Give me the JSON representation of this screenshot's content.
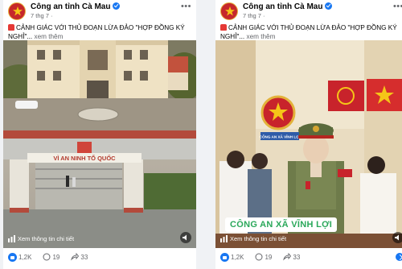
{
  "posts": [
    {
      "page_name": "Công an tỉnh Cà Mau",
      "time": "7 thg 7 ·",
      "caption": "CẢNH GIÁC VỚI THỦ ĐOẠN LỪA ĐẢO \"HỢP ĐỒNG KÝ NGHỈ\"...",
      "see_more": "xem thêm",
      "gate_sign": "VÌ AN NINH TỔ QUỐC",
      "watch_detail": "Xem thông tin chi tiết",
      "reactions": "1,2K",
      "comments": "19",
      "shares": "33"
    },
    {
      "page_name": "Công an tỉnh Cà Mau",
      "time": "7 thg 7 ·",
      "caption": "CẢNH GIÁC VỚI THỦ ĐOẠN LỪA ĐẢO \"HỢP ĐỒNG KÝ NGHỈ\"...",
      "see_more": "xem thêm",
      "board_sign": "CÔNG AN XÃ VĨNH LỢI",
      "banner": "CÔNG AN XÃ VĨNH LỢI",
      "watch_detail": "Xem thông tin chi tiết",
      "reactions": "1,2K",
      "comments": "19",
      "shares": "33"
    }
  ],
  "icons": [
    "star-emblem-icon",
    "verified-icon",
    "more-options-icon",
    "siren-icon",
    "info-icon",
    "speaker-icon",
    "like-icon",
    "comment-icon",
    "share-icon"
  ],
  "colors": {
    "accent": "#1877f2",
    "banner_text": "#2aa85a",
    "police_red": "#c6282b"
  }
}
